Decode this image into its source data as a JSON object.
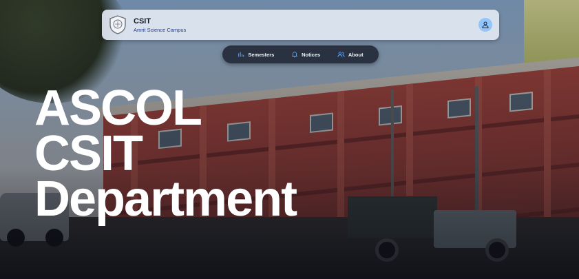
{
  "header": {
    "title": "CSIT",
    "subtitle": "Amrit Science Campus",
    "logo_icon": "college-seal-icon",
    "profile_icon": "user-icon",
    "accent_color": "#93c5fd"
  },
  "nav": {
    "items": [
      {
        "label": "Semesters",
        "icon": "bar-chart-icon"
      },
      {
        "label": "Notices",
        "icon": "bell-icon"
      },
      {
        "label": "About",
        "icon": "users-icon"
      }
    ],
    "icon_color": "#60a5fa"
  },
  "hero": {
    "lines": [
      "ASCOL",
      "CSIT",
      "Department"
    ]
  }
}
